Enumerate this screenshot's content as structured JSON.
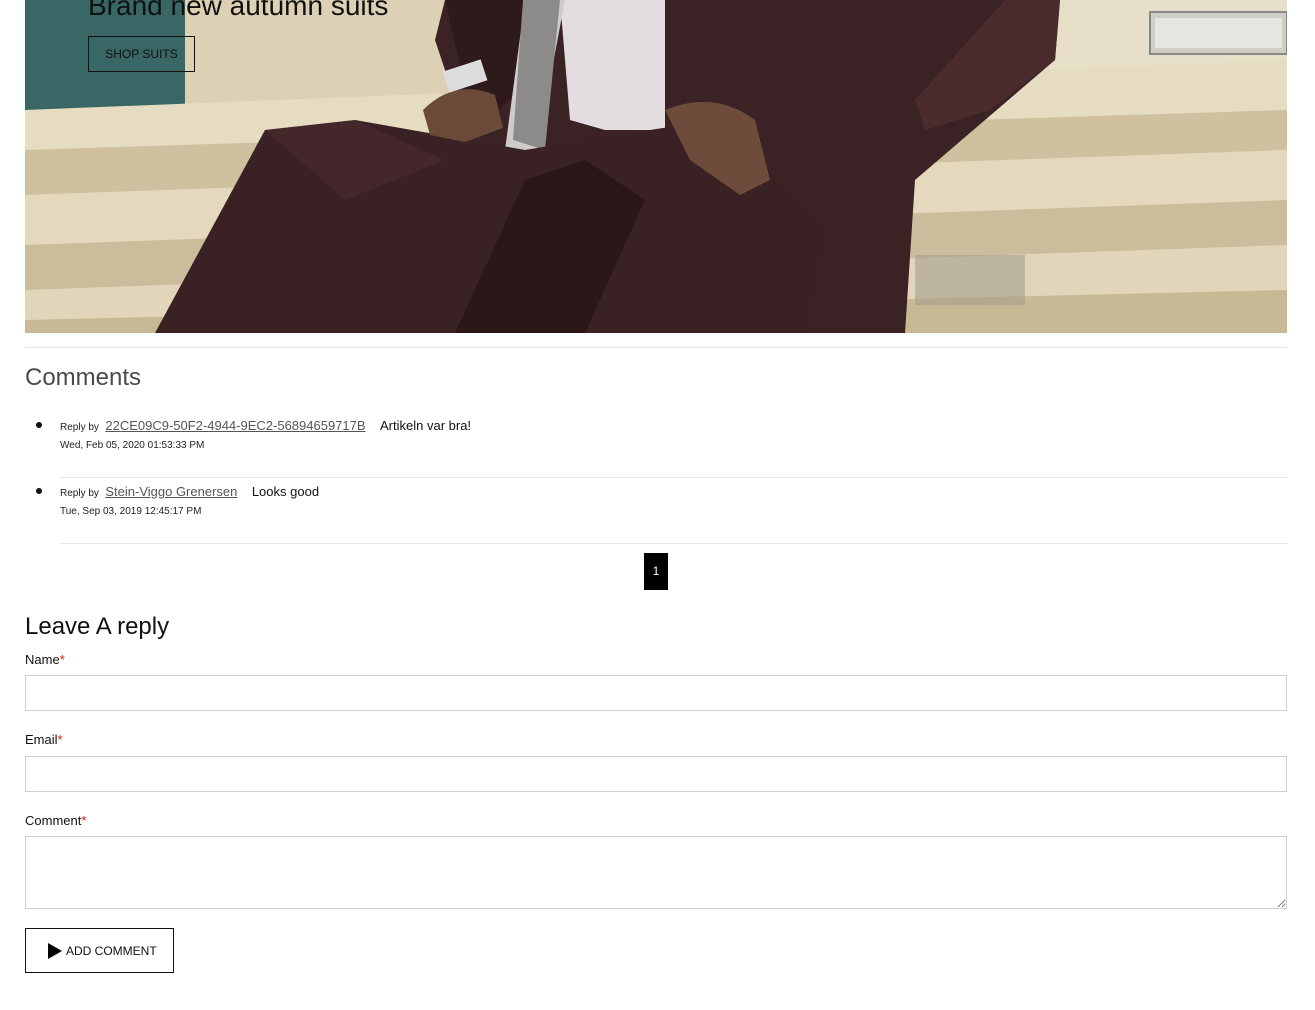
{
  "hero": {
    "title": "Brand new autumn suits",
    "button_label": "SHOP SUITS"
  },
  "comments": {
    "heading": "Comments",
    "items": [
      {
        "reply_by": "Reply by",
        "author": "22CE09C9-50F2-4944-9EC2-56894659717B",
        "text": "Artikeln var bra!",
        "date": "Wed, Feb 05, 2020 01:53:33 PM"
      },
      {
        "reply_by": "Reply by",
        "author": "Stein-Viggo Grenersen",
        "text": "Looks good",
        "date": "Tue, Sep 03, 2019 12:45:17 PM"
      }
    ],
    "pagination": {
      "current_page": "1"
    }
  },
  "reply_form": {
    "heading": "Leave A reply",
    "required_marker": "*",
    "name_label": "Name",
    "name_value": "",
    "email_label": "Email",
    "email_value": "",
    "comment_label": "Comment",
    "comment_value": "",
    "submit_label": "ADD COMMENT",
    "submit_icon": "play-icon"
  },
  "colors": {
    "required": "#e01010",
    "pager_background": "#000000",
    "comments_heading": "#4a4a4a"
  }
}
